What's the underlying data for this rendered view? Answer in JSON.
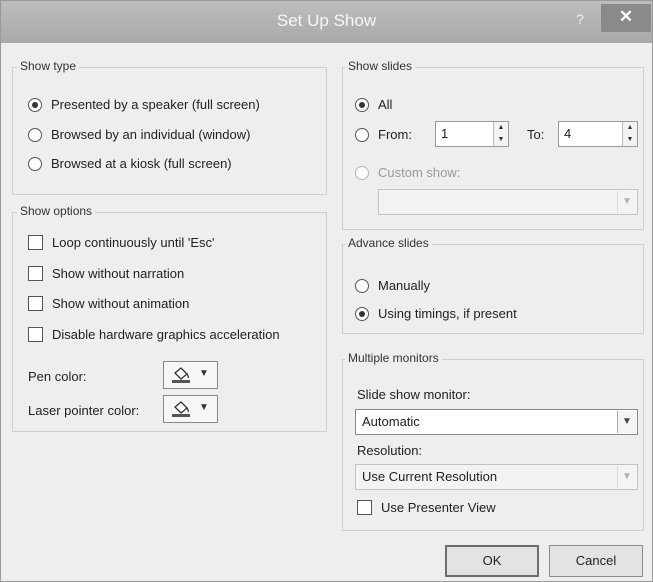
{
  "window": {
    "title": "Set Up Show",
    "help_label": "?",
    "close_label": "✕"
  },
  "show_type": {
    "title": "Show type",
    "options": [
      {
        "label": "Presented by a speaker (full screen)",
        "selected": true
      },
      {
        "label": "Browsed by an individual (window)",
        "selected": false
      },
      {
        "label": "Browsed at a kiosk (full screen)",
        "selected": false
      }
    ]
  },
  "show_options": {
    "title": "Show options",
    "checks": [
      {
        "label": "Loop continuously until 'Esc'",
        "checked": false
      },
      {
        "label": "Show without narration",
        "checked": false
      },
      {
        "label": "Show without animation",
        "checked": false
      },
      {
        "label": "Disable hardware graphics acceleration",
        "checked": false
      }
    ],
    "pen_color_label": "Pen color:",
    "laser_color_label": "Laser pointer color:"
  },
  "show_slides": {
    "title": "Show slides",
    "all_label": "All",
    "from_label": "From:",
    "from_value": "1",
    "to_label": "To:",
    "to_value": "4",
    "custom_label": "Custom show:",
    "custom_value": ""
  },
  "advance_slides": {
    "title": "Advance slides",
    "manually_label": "Manually",
    "timings_label": "Using timings, if present"
  },
  "monitors": {
    "title": "Multiple monitors",
    "monitor_label": "Slide show monitor:",
    "monitor_value": "Automatic",
    "resolution_label": "Resolution:",
    "resolution_value": "Use Current Resolution",
    "presenter_label": "Use Presenter View"
  },
  "buttons": {
    "ok": "OK",
    "cancel": "Cancel"
  },
  "icons": {
    "pen": "paint-bucket-icon",
    "dropdown": "chevron-down-icon",
    "spin": "spin-arrows-icon"
  }
}
